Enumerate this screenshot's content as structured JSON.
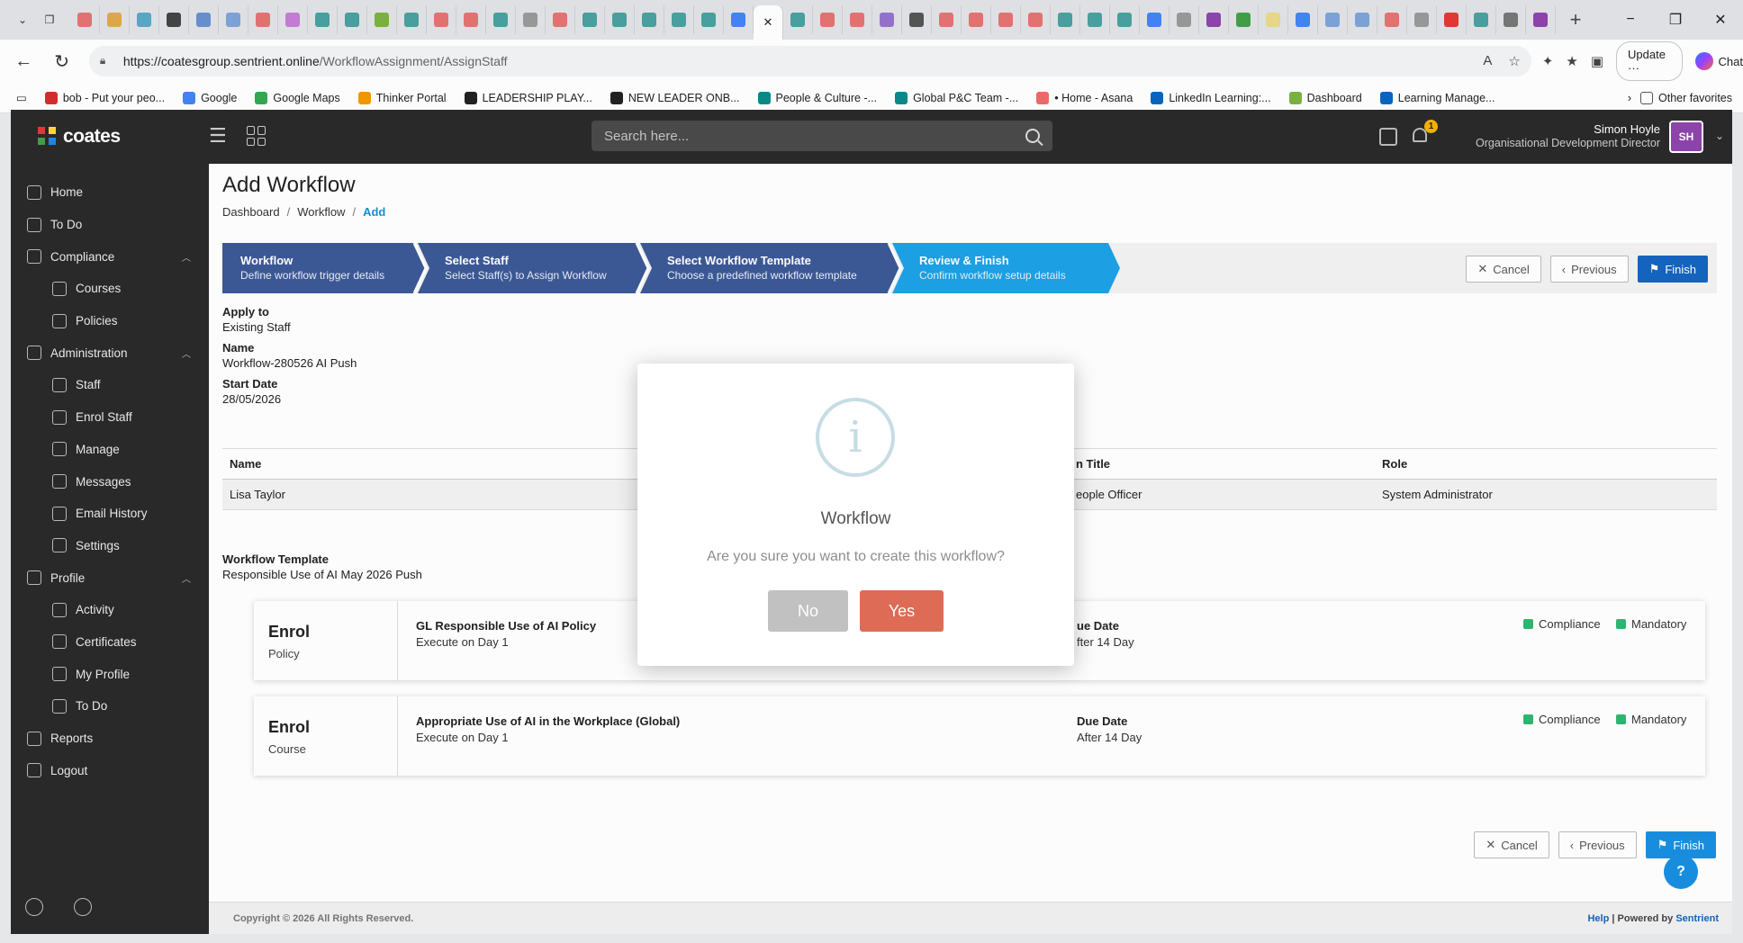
{
  "browser": {
    "url_host": "https://coatesgroup.sentrient.online",
    "url_path": "/WorkflowAssignment/AssignStaff",
    "update_label": "Update",
    "chat_label": "Chat",
    "favorites": [
      {
        "label": "bob - Put your peo...",
        "color": "#d32f2f"
      },
      {
        "label": "Google",
        "color": "#4285f4"
      },
      {
        "label": "Google Maps",
        "color": "#34a853"
      },
      {
        "label": "Thinker Portal",
        "color": "#f29900"
      },
      {
        "label": "LEADERSHIP PLAY...",
        "color": "#222222"
      },
      {
        "label": "NEW LEADER ONB...",
        "color": "#222222"
      },
      {
        "label": "People & Culture -...",
        "color": "#0b8a8a"
      },
      {
        "label": "Global P&C Team -...",
        "color": "#0b8a8a"
      },
      {
        "label": "• Home - Asana",
        "color": "#f06a6a"
      },
      {
        "label": "LinkedIn Learning:...",
        "color": "#0a66c2"
      },
      {
        "label": "Dashboard",
        "color": "#7cb342"
      },
      {
        "label": "Learning Manage...",
        "color": "#0a66c2"
      }
    ],
    "other_favorites": "Other favorites"
  },
  "app": {
    "logo_text": "coates",
    "search_placeholder": "Search here...",
    "notification_count": "1",
    "user_name": "Simon Hoyle",
    "user_role": "Organisational Development Director",
    "user_initials": "SH"
  },
  "sidebar": {
    "items": [
      {
        "label": "Home",
        "sub": false,
        "caret": false
      },
      {
        "label": "To Do",
        "sub": false,
        "caret": false
      },
      {
        "label": "Compliance",
        "sub": false,
        "caret": true
      },
      {
        "label": "Courses",
        "sub": true,
        "caret": false
      },
      {
        "label": "Policies",
        "sub": true,
        "caret": false
      },
      {
        "label": "Administration",
        "sub": false,
        "caret": true
      },
      {
        "label": "Staff",
        "sub": true,
        "caret": false
      },
      {
        "label": "Enrol Staff",
        "sub": true,
        "caret": false
      },
      {
        "label": "Manage",
        "sub": true,
        "caret": false
      },
      {
        "label": "Messages",
        "sub": true,
        "caret": false
      },
      {
        "label": "Email History",
        "sub": true,
        "caret": false
      },
      {
        "label": "Settings",
        "sub": true,
        "caret": false
      },
      {
        "label": "Profile",
        "sub": false,
        "caret": true
      },
      {
        "label": "Activity",
        "sub": true,
        "caret": false
      },
      {
        "label": "Certificates",
        "sub": true,
        "caret": false
      },
      {
        "label": "My Profile",
        "sub": true,
        "caret": false
      },
      {
        "label": "To Do",
        "sub": true,
        "caret": false
      },
      {
        "label": "Reports",
        "sub": false,
        "caret": false
      },
      {
        "label": "Logout",
        "sub": false,
        "caret": false
      }
    ]
  },
  "page": {
    "title": "Add Workflow",
    "breadcrumb": [
      "Dashboard",
      "Workflow",
      "Add"
    ]
  },
  "wizard": {
    "steps": [
      {
        "title": "Workflow",
        "desc": "Define workflow trigger details",
        "color": "#3d5a96"
      },
      {
        "title": "Select Staff",
        "desc": "Select Staff(s) to Assign Workflow",
        "color": "#3d5a96"
      },
      {
        "title": "Select Workflow Template",
        "desc": "Choose a predefined workflow template",
        "color": "#3d5a96"
      },
      {
        "title": "Review & Finish",
        "desc": "Confirm workflow setup details",
        "color": "#1da1e6"
      }
    ],
    "cancel": "Cancel",
    "previous": "Previous",
    "finish": "Finish"
  },
  "details": {
    "apply_to_label": "Apply to",
    "apply_to_value": "Existing Staff",
    "name_label": "Name",
    "name_value": "Workflow-280526 AI Push",
    "start_label": "Start Date",
    "start_value": "28/05/2026"
  },
  "staff_table": {
    "headers": [
      "Name",
      "n Title",
      "Role"
    ],
    "rows": [
      [
        "Lisa Taylor",
        "eople Officer",
        "System Administrator"
      ]
    ]
  },
  "template": {
    "label": "Workflow Template",
    "value": "Responsible Use of AI May 2026 Push"
  },
  "workflow_items": [
    {
      "type": "Enrol",
      "kind": "Policy",
      "title": "GL Responsible Use of AI Policy",
      "exec": "Execute on Day 1",
      "due_label": "ue Date",
      "due_value": "fter 14 Day",
      "tag1": "Compliance",
      "tag2": "Mandatory"
    },
    {
      "type": "Enrol",
      "kind": "Course",
      "title": "Appropriate Use of AI in the Workplace (Global)",
      "exec": "Execute on Day 1",
      "due_label": "Due Date",
      "due_value": "After 14 Day",
      "tag1": "Compliance",
      "tag2": "Mandatory"
    }
  ],
  "footer": {
    "copyright": "Copyright © 2026 All Rights Reserved.",
    "help": "Help",
    "powered": "| Powered by",
    "brand": "Sentrient"
  },
  "dialog": {
    "title": "Workflow",
    "message": "Are you sure you want to create this workflow?",
    "no_label": "No",
    "yes_label": "Yes"
  },
  "colors": {
    "accent": "#1565c0",
    "active_step": "#1da1e6",
    "step": "#3d5a96",
    "yes": "#dd6b55",
    "no": "#c1c1c1",
    "tag": "#2eb872"
  }
}
